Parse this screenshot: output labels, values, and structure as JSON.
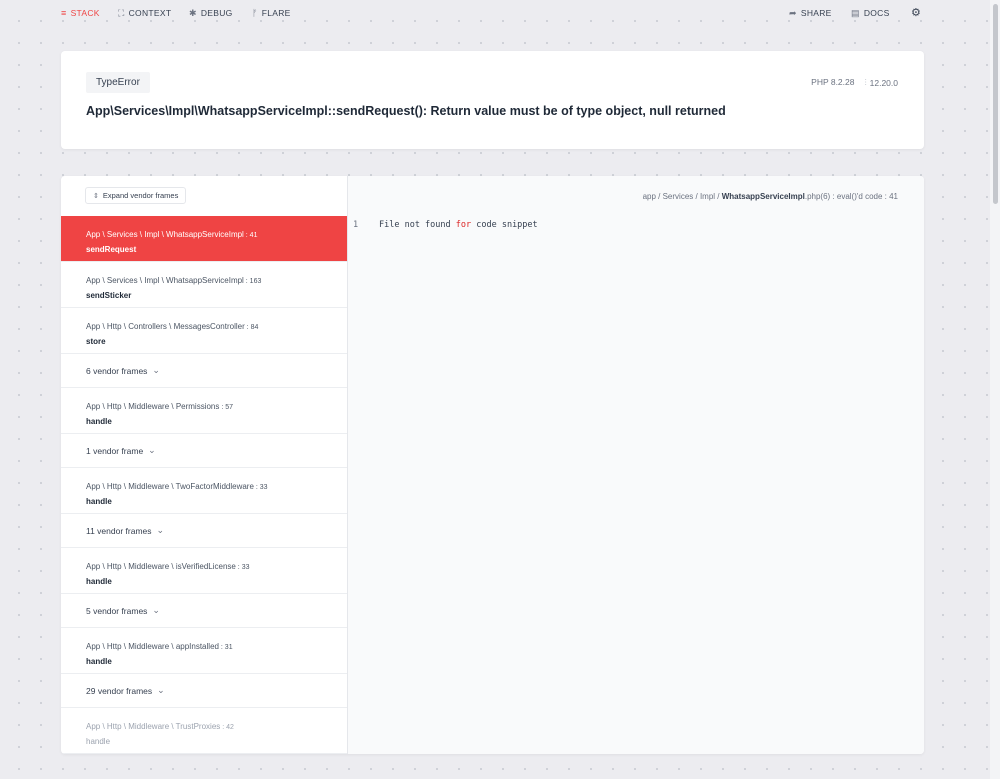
{
  "nav": {
    "stack": "STACK",
    "context": "CONTEXT",
    "debug": "DEBUG",
    "flare": "FLARE",
    "share": "SHARE",
    "docs": "DOCS"
  },
  "error": {
    "type": "TypeError",
    "message": "App\\Services\\Impl\\WhatsappServiceImpl::sendRequest(): Return value must be of type object, null returned",
    "php_version": "PHP 8.2.28",
    "laravel_version": "12.20.0"
  },
  "stack": {
    "expand_label": "Expand vendor frames",
    "frames": [
      {
        "kind": "app",
        "path": "App \\ Services \\ Impl \\ WhatsappServiceImpl",
        "line": " : 41",
        "method": "sendRequest",
        "selected": true
      },
      {
        "kind": "app",
        "path": "App \\ Services \\ Impl \\ WhatsappServiceImpl",
        "line": " : 163",
        "method": "sendSticker"
      },
      {
        "kind": "app",
        "path": "App \\ Http \\ Controllers \\ MessagesController",
        "line": " : 84",
        "method": "store"
      },
      {
        "kind": "vendor",
        "label": "6 vendor frames"
      },
      {
        "kind": "app",
        "path": "App \\ Http \\ Middleware \\ Permissions",
        "line": " : 57",
        "method": "handle"
      },
      {
        "kind": "vendor",
        "label": "1 vendor frame"
      },
      {
        "kind": "app",
        "path": "App \\ Http \\ Middleware \\ TwoFactorMiddleware",
        "line": " : 33",
        "method": "handle"
      },
      {
        "kind": "vendor",
        "label": "11 vendor frames"
      },
      {
        "kind": "app",
        "path": "App \\ Http \\ Middleware \\ isVerifiedLicense",
        "line": " : 33",
        "method": "handle"
      },
      {
        "kind": "vendor",
        "label": "5 vendor frames"
      },
      {
        "kind": "app",
        "path": "App \\ Http \\ Middleware \\ appInstalled",
        "line": " : 31",
        "method": "handle"
      },
      {
        "kind": "vendor",
        "label": "29 vendor frames"
      },
      {
        "kind": "app",
        "path": "App \\ Http \\ Middleware \\ TrustProxies",
        "line": " : 42",
        "method": "handle",
        "faded": true
      }
    ]
  },
  "code": {
    "path_prefix": "app / Services / Impl / ",
    "file_name": "WhatsappServiceImpl",
    "path_suffix": ".php(6) : eval()'d code : 41",
    "line_number": "1",
    "text_before": "File not found ",
    "keyword": "for",
    "text_after": " code snippet"
  },
  "colors": {
    "accent": "#ef4444",
    "background": "#ececf0"
  }
}
